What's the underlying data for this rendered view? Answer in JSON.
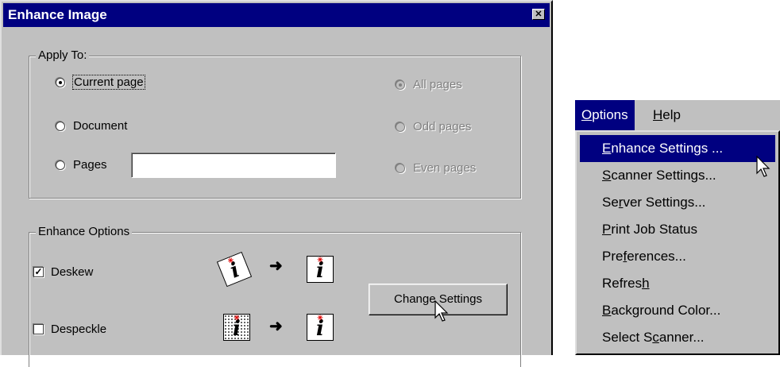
{
  "dialog": {
    "title": "Enhance Image",
    "close_glyph": "✕",
    "apply_to": {
      "legend": "Apply To:",
      "options": [
        {
          "label": "Current page",
          "checked": true,
          "enabled": true
        },
        {
          "label": "Document",
          "checked": false,
          "enabled": true
        },
        {
          "label": "Pages",
          "checked": false,
          "enabled": true
        },
        {
          "label": "All pages",
          "checked": true,
          "enabled": false
        },
        {
          "label": "Odd pages",
          "checked": false,
          "enabled": false
        },
        {
          "label": "Even pages",
          "checked": false,
          "enabled": false
        }
      ],
      "pages_value": ""
    },
    "enhance_options": {
      "legend": "Enhance Options",
      "deskew_label": "Deskew",
      "deskew_checked": true,
      "despeckle_label": "Despeckle",
      "despeckle_checked": false,
      "icon_glyph": "i",
      "spark_glyph": "✳",
      "arrow_glyph": "➜",
      "check_glyph": "✓",
      "change_settings_label": "Change Settings"
    }
  },
  "menubar": {
    "options": {
      "mnemonic": "O",
      "rest": "ptions"
    },
    "help": {
      "mnemonic": "H",
      "rest": "elp"
    }
  },
  "menu_items": [
    {
      "pre": "",
      "mn": "E",
      "post": "nhance Settings ..."
    },
    {
      "pre": "",
      "mn": "S",
      "post": "canner Settings..."
    },
    {
      "pre": "Se",
      "mn": "r",
      "post": "ver Settings..."
    },
    {
      "pre": "",
      "mn": "P",
      "post": "rint Job Status"
    },
    {
      "pre": "Pre",
      "mn": "f",
      "post": "erences..."
    },
    {
      "pre": "Refres",
      "mn": "h",
      "post": ""
    },
    {
      "pre": "",
      "mn": "B",
      "post": "ackground Color..."
    },
    {
      "pre": "Select S",
      "mn": "c",
      "post": "anner..."
    }
  ],
  "colors": {
    "titlebar": "#000080",
    "face": "#c0c0c0",
    "highlight": "#000080"
  }
}
